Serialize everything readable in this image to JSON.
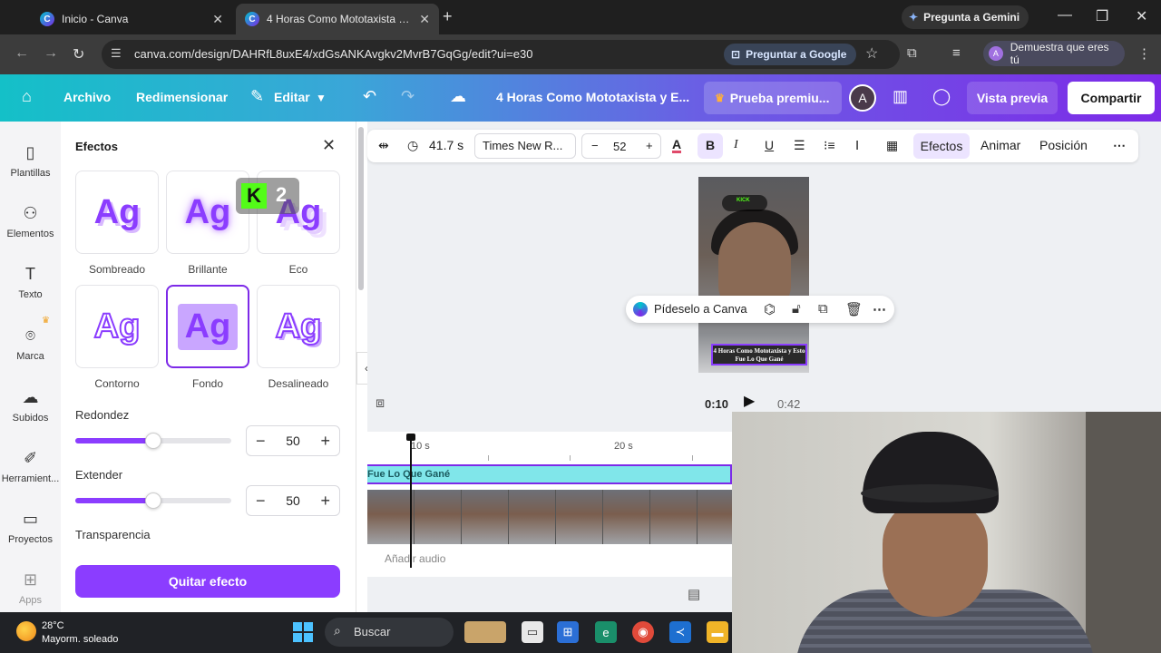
{
  "browser": {
    "tabs": [
      {
        "title": "Inicio - Canva"
      },
      {
        "title": "4 Horas Como Mototaxista y Esto Fue Lo Que Gané"
      }
    ],
    "gemini_label": "Pregunta a Gemini",
    "url": "canva.com/design/DAHRfL8uxE4/xdGsANKAvgkv2MvrB7GqGg/edit?ui=e30",
    "ask_google_label": "Preguntar a Google",
    "profile_label": "Demuestra que eres tú",
    "profile_initial": "A"
  },
  "canva_header": {
    "archivo": "Archivo",
    "redimensionar": "Redimensionar",
    "editar": "Editar",
    "doc_title": "4 Horas Como Mototaxista y E...",
    "premium_label": "Prueba premiu...",
    "avatar_initial": "A",
    "preview_label": "Vista previa",
    "share_label": "Compartir"
  },
  "rail": [
    {
      "label": "Plantillas",
      "icon": "templates-icon"
    },
    {
      "label": "Elementos",
      "icon": "elements-icon"
    },
    {
      "label": "Texto",
      "icon": "text-icon"
    },
    {
      "label": "Marca",
      "icon": "brand-icon"
    },
    {
      "label": "Subidos",
      "icon": "uploads-icon"
    },
    {
      "label": "Herramient...",
      "icon": "tools-icon"
    },
    {
      "label": "Proyectos",
      "icon": "projects-icon"
    },
    {
      "label": "Apps",
      "icon": "apps-icon"
    }
  ],
  "effects_panel": {
    "title": "Efectos",
    "sample": "Ag",
    "effects": [
      {
        "label": "Sombreado"
      },
      {
        "label": "Brillante"
      },
      {
        "label": "Eco"
      },
      {
        "label": "Contorno"
      },
      {
        "label": "Fondo",
        "selected": true
      },
      {
        "label": "Desalineado"
      }
    ],
    "kick_overlay": {
      "letter": "K",
      "number": "2"
    },
    "sliders": [
      {
        "label": "Redondez",
        "value": "50",
        "fraction": 0.5
      },
      {
        "label": "Extender",
        "value": "50",
        "fraction": 0.5
      },
      {
        "label": "Transparencia"
      }
    ],
    "remove_label": "Quitar efecto"
  },
  "toolbar": {
    "duration": "41.7 s",
    "font": "Times New R...",
    "size": "52",
    "effects": "Efectos",
    "animate": "Animar",
    "position": "Posición"
  },
  "canvas": {
    "kick_badge": "KICK",
    "caption": "4 Horas Como Mototaxista y Esto Fue Lo Que Gané",
    "context_menu_label": "Pídeselo a Canva"
  },
  "playback": {
    "current": "0:10",
    "total": "0:42"
  },
  "timeline": {
    "ticks": [
      "10 s",
      "20 s"
    ],
    "text_clip": "Fue Lo Que Gané",
    "add_audio": "Añadir audio"
  },
  "taskbar": {
    "temp": "28°C",
    "weather": "Mayorm. soleado",
    "search": "Buscar"
  },
  "colors": {
    "accent": "#8b3dff",
    "header_start": "#14c0c8",
    "header_end": "#7d2ae8",
    "kick_green": "#53fc18"
  }
}
